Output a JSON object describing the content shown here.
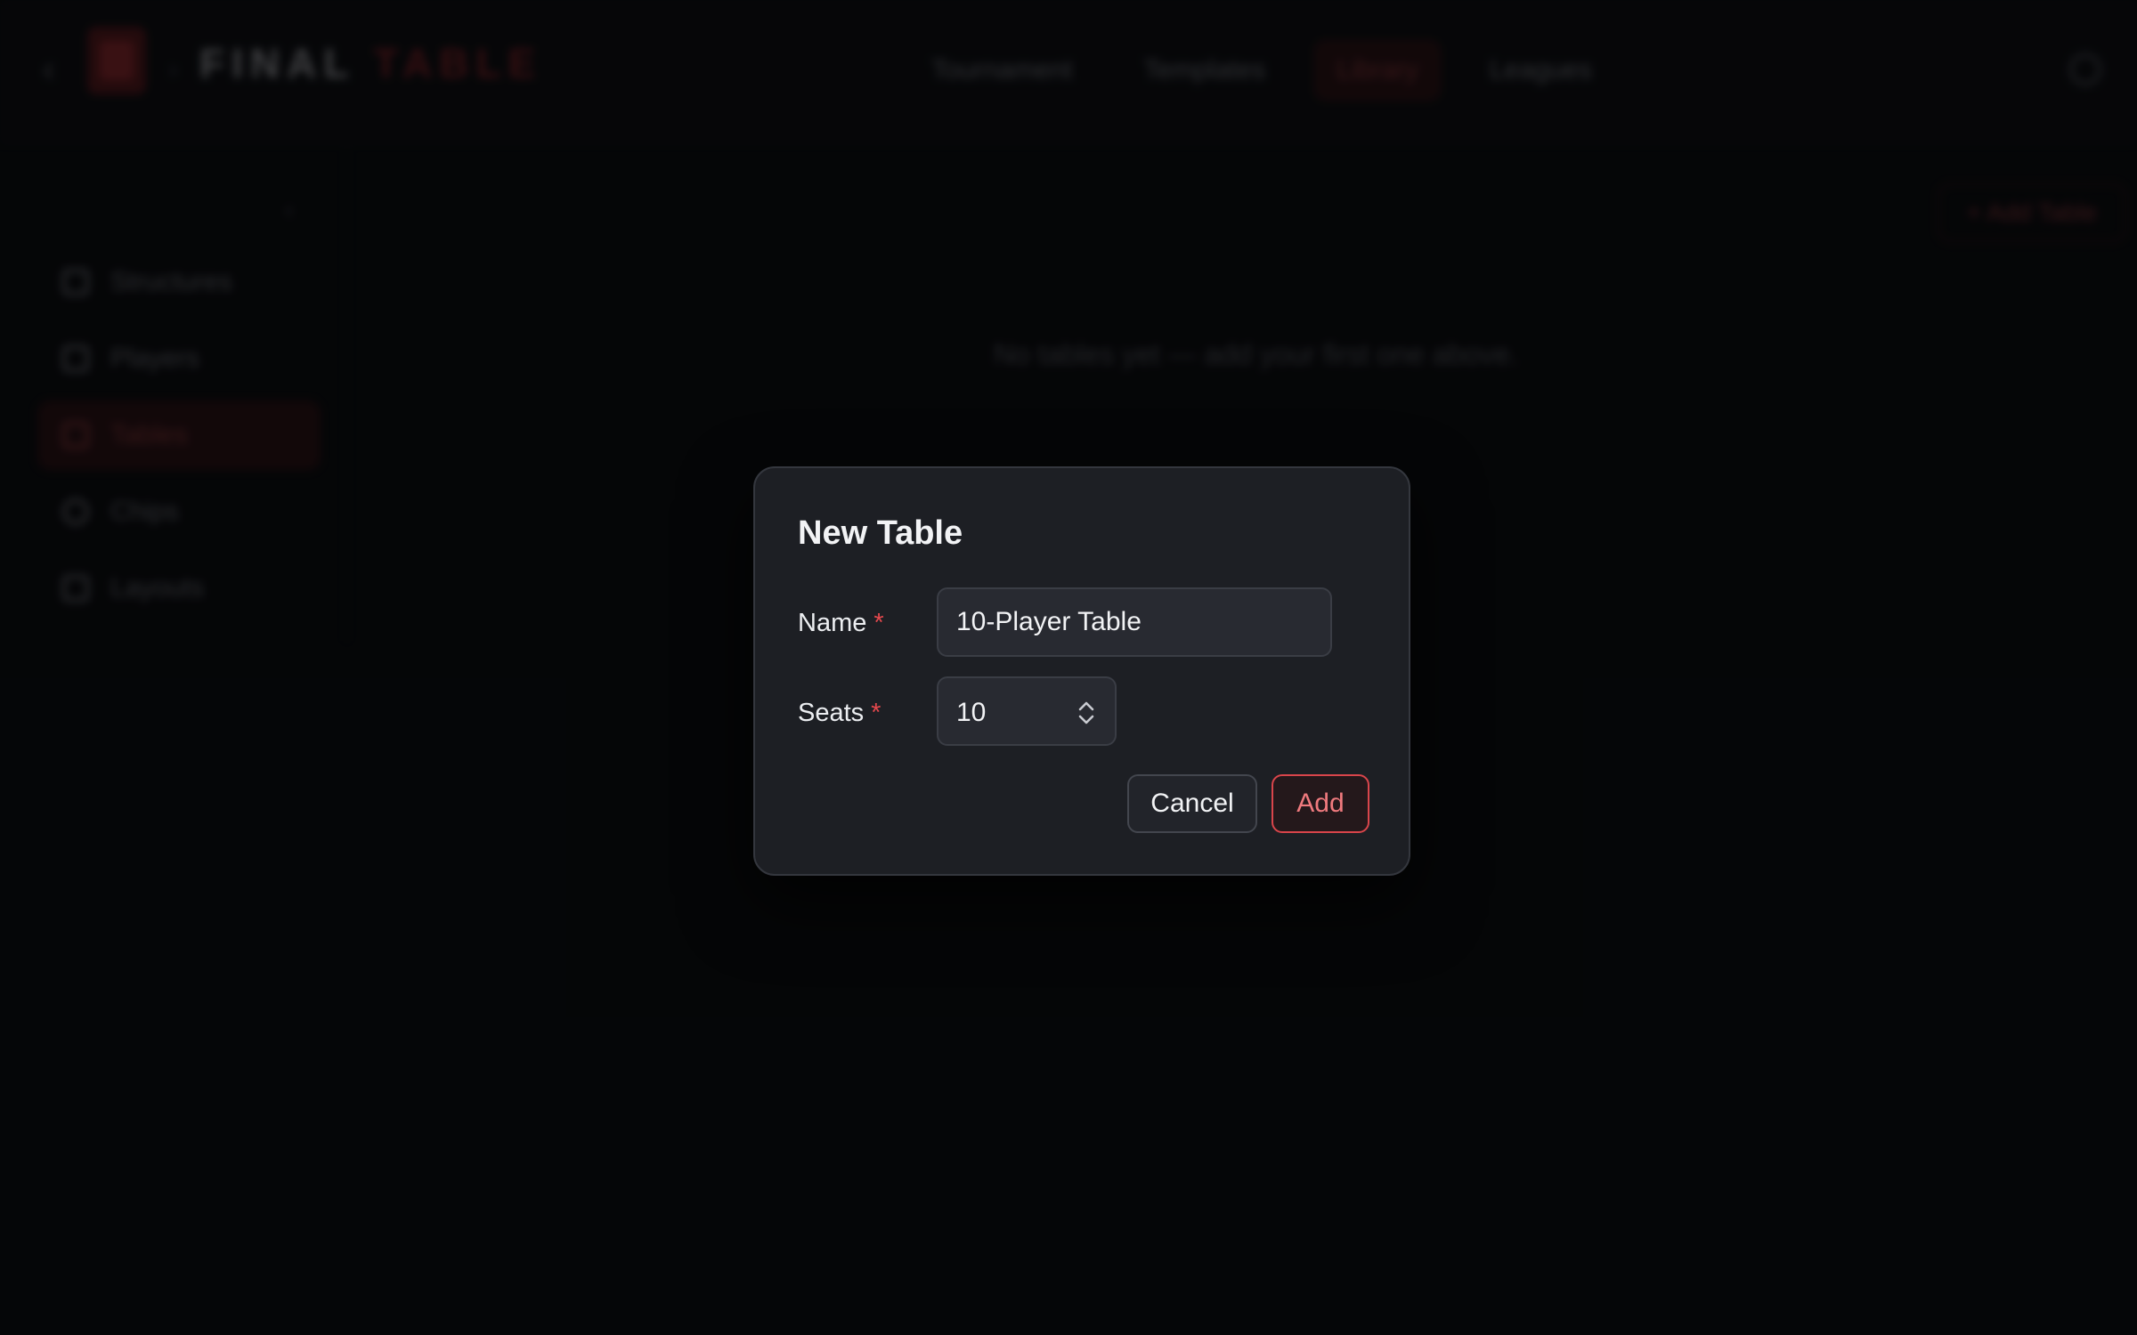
{
  "header": {
    "back_icon": "chevron-left-icon",
    "logo_word1": "FINAL",
    "logo_word2": "TABLE",
    "nav": [
      {
        "label": "Tournament"
      },
      {
        "label": "Templates"
      },
      {
        "label": "Library",
        "active": true
      },
      {
        "label": "Leagues"
      }
    ],
    "settings_icon": "gear-icon"
  },
  "sidebar": {
    "collapse_icon": "chevron-left-icon",
    "items": [
      {
        "label": "Structures",
        "icon": "grid-icon"
      },
      {
        "label": "Players",
        "icon": "users-icon"
      },
      {
        "label": "Tables",
        "icon": "table-icon",
        "active": true
      },
      {
        "label": "Chips",
        "icon": "chip-icon"
      },
      {
        "label": "Layouts",
        "icon": "layout-icon"
      }
    ]
  },
  "main": {
    "add_button_label": "+ Add Table",
    "empty_message": "No tables yet — add your first one above."
  },
  "modal": {
    "title": "New Table",
    "name_label": "Name",
    "name_value": "10-Player Table",
    "seats_label": "Seats",
    "seats_value": "10",
    "required_mark": "*",
    "cancel_label": "Cancel",
    "add_label": "Add"
  },
  "colors": {
    "accent": "#d9454b",
    "required": "#e5484d",
    "modal_bg": "#1d1f24"
  }
}
